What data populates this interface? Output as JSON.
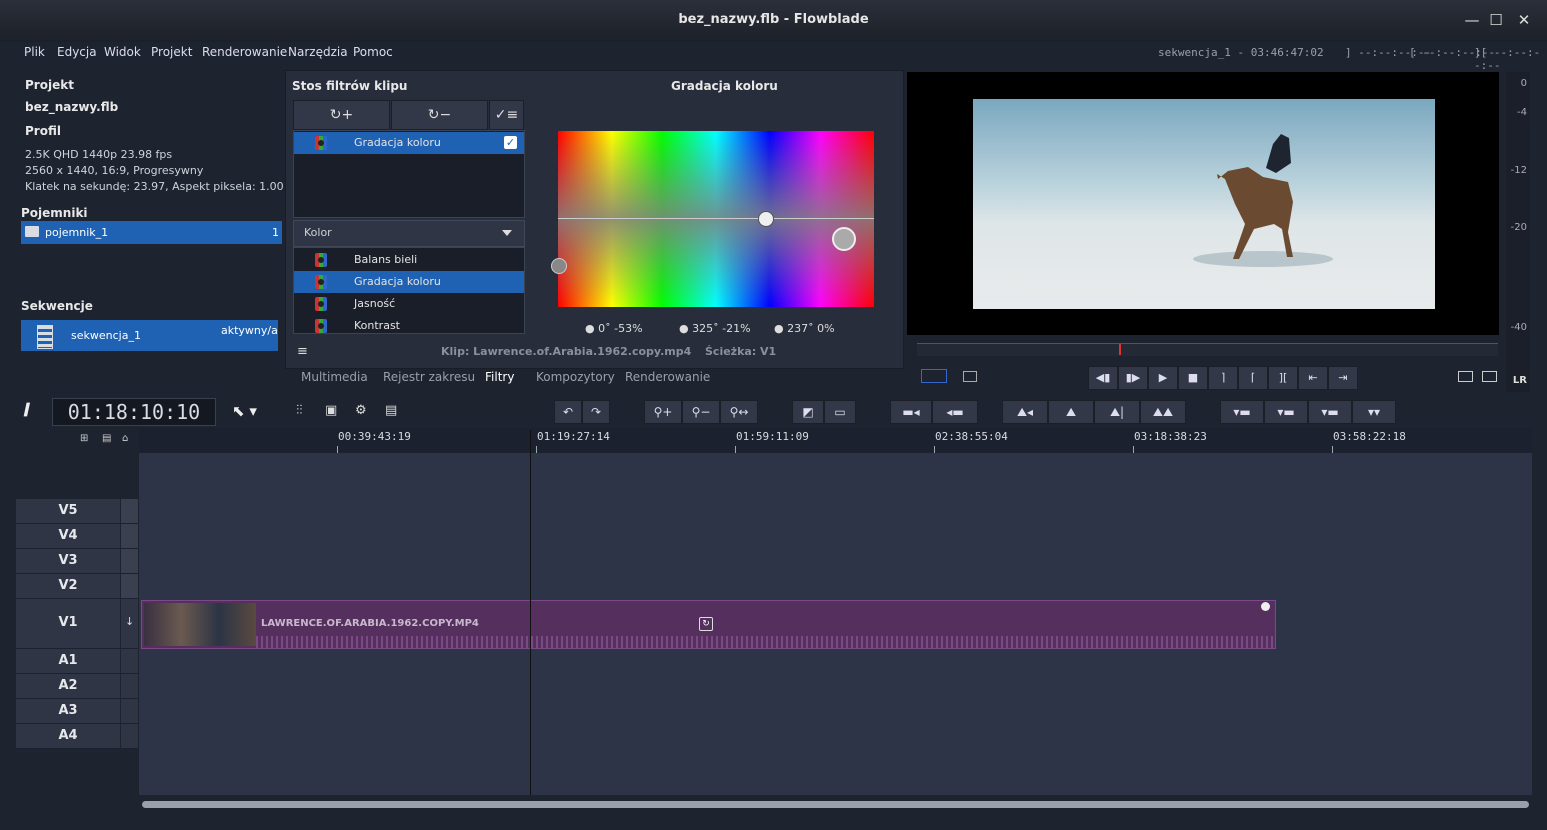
{
  "window": {
    "title": "bez_nazwy.flb - Flowblade"
  },
  "menu": [
    "Plik",
    "Edycja",
    "Widok",
    "Projekt",
    "Renderowanie",
    "Narzędzia",
    "Pomoc"
  ],
  "timecode_header": {
    "sequence": "sekwencja_1  -  03:46:47:02",
    "mark_in": "] --:--:--:--",
    "mark_out": "[ --:--:--:--",
    "length": "][ --:--:--:--"
  },
  "project": {
    "heading": "Projekt",
    "name": "bez_nazwy.flb",
    "profile_heading": "Profil",
    "profile_lines": [
      "2.5K QHD 1440p 23.98 fps",
      "2560 x 1440, 16:9, Progresywny",
      "Klatek na sekundę: 23.97, Aspekt piksela: 1.00"
    ],
    "bins_heading": "Pojemniki",
    "bin": {
      "name": "pojemnik_1",
      "count": "1"
    },
    "sequences_heading": "Sekwencje",
    "sequence": {
      "name": "sekwencja_1",
      "status": "aktywny/a"
    }
  },
  "filters": {
    "stack_heading": "Stos filtrów klipu",
    "add_label": "↻+",
    "remove_label": "↻−",
    "stack": [
      {
        "name": "Gradacja koloru",
        "enabled": true
      }
    ],
    "category": "Kolor",
    "available": [
      "Balans bieli",
      "Gradacja koloru",
      "Jasność",
      "Kontrast"
    ],
    "selected_index": 1,
    "editor_heading": "Gradacja koloru",
    "points": [
      "0˚ -53%",
      "325˚ -21%",
      "237˚ 0%"
    ],
    "clip_info": "Klip: Lawrence.of.Arabia.1962.copy.mp4",
    "track_info": "Ścieżka: V1"
  },
  "tabs": [
    "Multimedia",
    "Rejestr zakresu",
    "Filtry",
    "Kompozytory",
    "Renderowanie"
  ],
  "active_tab": "Filtry",
  "meter_labels": [
    "0",
    "-4",
    "-12",
    "-20",
    "-40"
  ],
  "meter_channels": "LR",
  "timeline": {
    "timecode": "01:18:10:10",
    "ruler": [
      "00:39:43:19",
      "01:19:27:14",
      "01:59:11:09",
      "02:38:55:04",
      "03:18:38:23",
      "03:58:22:18"
    ],
    "tracks": [
      "V5",
      "V4",
      "V3",
      "V2",
      "V1",
      "A1",
      "A2",
      "A3",
      "A4"
    ],
    "clip_name": "LAWRENCE.OF.ARABIA.1962.COPY.MP4"
  }
}
